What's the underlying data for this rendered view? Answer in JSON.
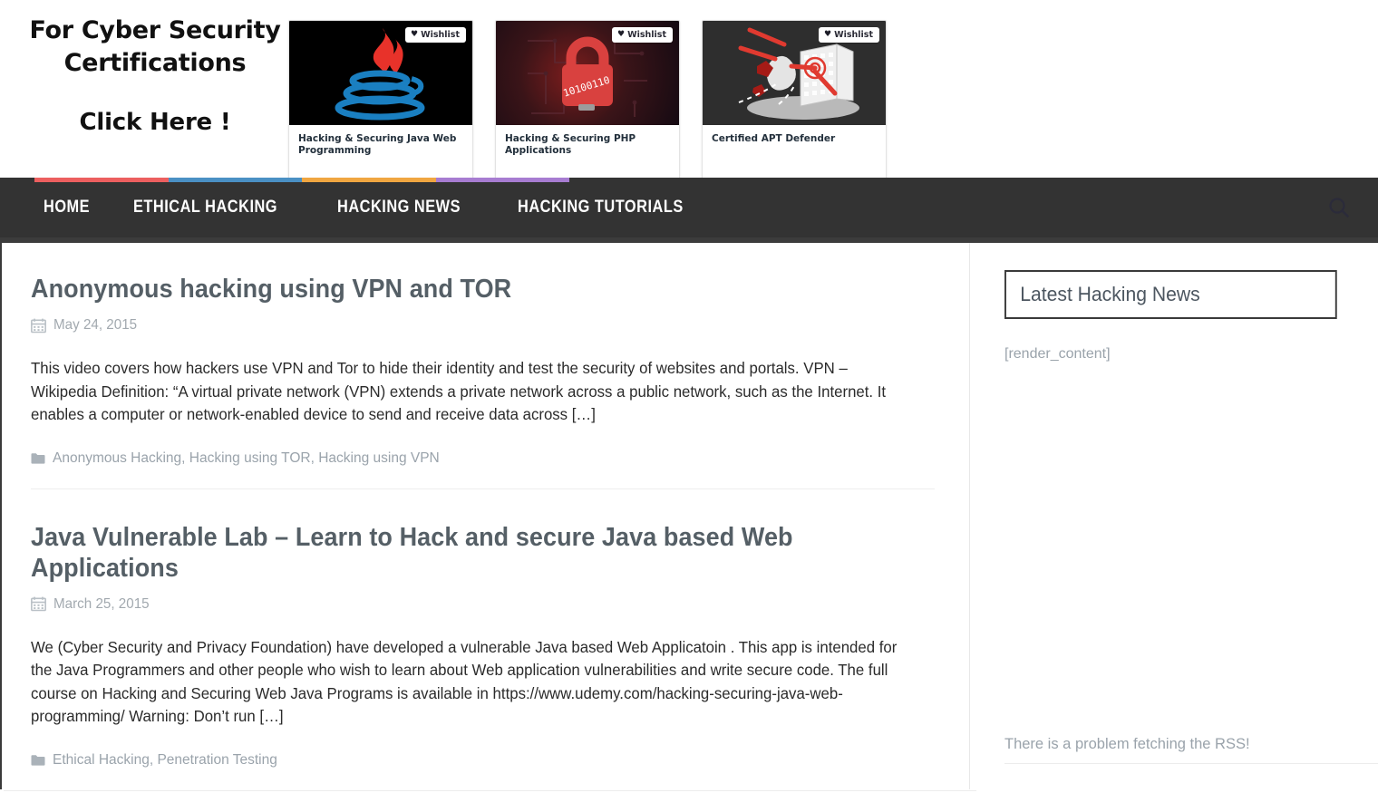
{
  "banner": {
    "promo": {
      "line1": "For Cyber Security Certifications",
      "line2": "Click Here !"
    },
    "wishlist_label": "Wishlist",
    "heart_glyph": "♥",
    "courses": [
      {
        "title": "Hacking & Securing Java Web Programming",
        "art": "java-logo-icon"
      },
      {
        "title": "Hacking & Securing PHP Applications",
        "art": "padlock-circuit-icon"
      },
      {
        "title": "Certified APT Defender",
        "art": "building-target-icon"
      }
    ]
  },
  "nav": {
    "items": [
      {
        "label": "HOME"
      },
      {
        "label": "ETHICAL HACKING"
      },
      {
        "label": "HACKING NEWS"
      },
      {
        "label": "HACKING TUTORIALS"
      }
    ],
    "search_icon": "search-icon",
    "background": "#333333",
    "accent_segments": [
      "#ec5f5f",
      "#4a90c4",
      "#f0a641",
      "#a77cd1"
    ]
  },
  "posts": [
    {
      "title": "Anonymous hacking using VPN and TOR",
      "date": "May 24, 2015",
      "excerpt": "This video covers how hackers use VPN and Tor to hide their identity and test the security of websites and portals. VPN – Wikipedia Definition: “A virtual private network (VPN) extends a private network across a public network, such as the Internet. It enables a computer or network-enabled device to send and receive data across […]",
      "categories": "Anonymous Hacking, Hacking using TOR, Hacking using VPN"
    },
    {
      "title": "Java Vulnerable Lab – Learn to Hack and secure Java based Web Applications",
      "date": "March 25, 2015",
      "excerpt": "We (Cyber Security and Privacy Foundation) have developed a vulnerable Java based Web Applicatoin . This app is intended for the Java Programmers and other people who wish to learn about Web application vulnerabilities and write secure code. The full course on Hacking and Securing Web Java Programs is available in https://www.udemy.com/hacking-securing-java-web-programming/ Warning: Don’t run […]",
      "categories": "Ethical Hacking, Penetration Testing"
    }
  ],
  "sidebar": {
    "widget_title": "Latest Hacking News",
    "widget_body": "[render_content]",
    "rss_error": "There is a problem fetching the RSS!"
  }
}
